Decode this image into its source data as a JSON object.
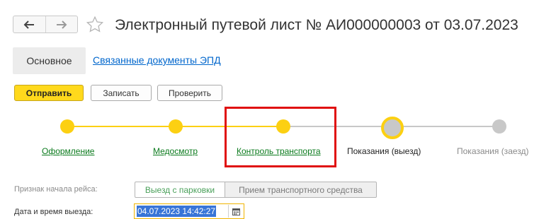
{
  "header": {
    "back_icon": "arrow-left-icon",
    "forward_icon": "arrow-right-icon",
    "favorite_icon": "star-outline-icon",
    "title": "Электронный путевой лист № АИ000000003 от 03.07.2023"
  },
  "tabs": [
    {
      "label": "Основное",
      "active": true
    },
    {
      "label": "Связанные документы ЭПД",
      "active": false
    }
  ],
  "toolbar": {
    "send_label": "Отправить",
    "save_label": "Записать",
    "check_label": "Проверить"
  },
  "stepper": {
    "steps": [
      {
        "label": "Оформление",
        "state": "done"
      },
      {
        "label": "Медосмотр",
        "state": "done"
      },
      {
        "label": "Контроль транспорта",
        "state": "done"
      },
      {
        "label": "Показания (выезд)",
        "state": "current"
      },
      {
        "label": "Показания (заезд)",
        "state": "pending"
      }
    ]
  },
  "form": {
    "trip_start_label": "Признак начала рейса:",
    "trip_start_options": [
      "Выезд с парковки",
      "Прием транспортного средства"
    ],
    "trip_start_selected": "Выезд с парковки",
    "departure_label": "Дата и время выезда:",
    "departure_value": "04.07.2023 14:42:27",
    "calendar_icon": "calendar-icon"
  },
  "colors": {
    "accent_yellow": "#fcd012",
    "link_blue": "#0066cc",
    "link_green": "#0a7a1c",
    "highlight_red": "#e01010",
    "pending_gray": "#c8c8c8",
    "selection_blue": "#3875d7"
  }
}
